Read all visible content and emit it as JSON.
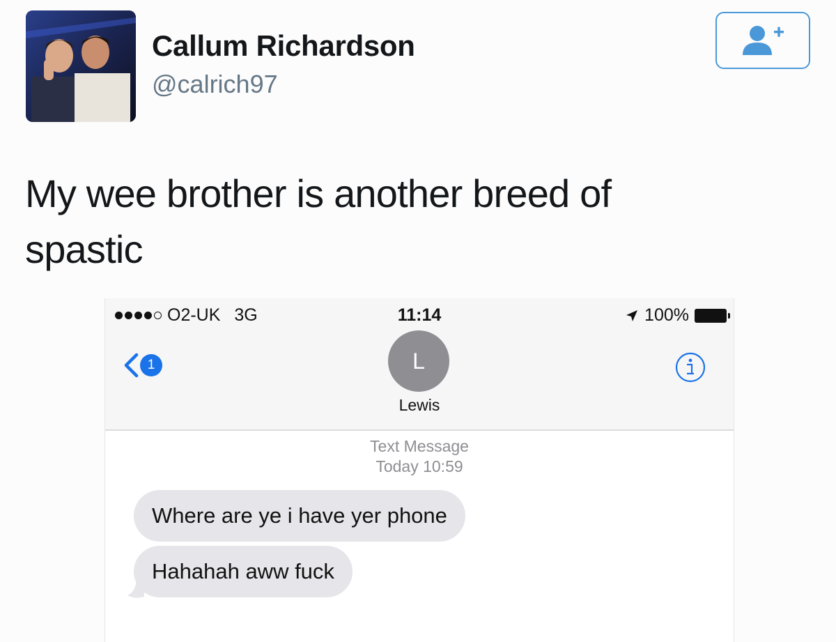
{
  "tweet": {
    "display_name": "Callum Richardson",
    "handle": "@calrich97",
    "text": "My wee brother is another breed of spastic",
    "follow_icon": "add-user-icon",
    "accent_color": "#4a98d8"
  },
  "phone": {
    "status_bar": {
      "carrier": "O2-UK",
      "network": "3G",
      "time": "11:14",
      "battery": "100%",
      "signal_bars": 4
    },
    "nav": {
      "back_badge": "1",
      "contact_initial": "L",
      "contact_name": "Lewis",
      "info_icon": "info-icon"
    },
    "thread": {
      "service_label": "Text Message",
      "timestamp": "Today 10:59",
      "messages": [
        {
          "text": "Where are ye i have yer phone"
        },
        {
          "text": "Hahahah aww fuck"
        }
      ]
    }
  }
}
